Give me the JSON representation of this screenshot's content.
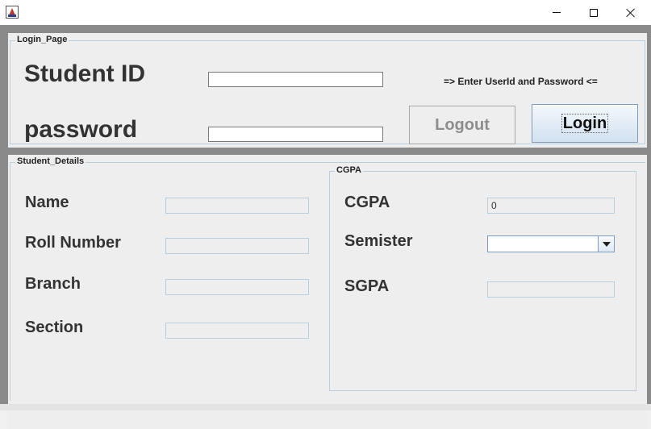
{
  "window": {
    "icons": {
      "app": "java-cup-icon",
      "minimize": "minimize-icon",
      "maximize": "maximize-icon",
      "close": "close-icon"
    }
  },
  "login_panel": {
    "legend": "Login_Page",
    "student_id_label": "Student ID",
    "student_id_value": "",
    "password_label": "password",
    "password_value": "",
    "hint": "=> Enter UserId and Password <=",
    "logout_label": "Logout",
    "login_label": "Login"
  },
  "details_panel": {
    "legend": "Student_Details",
    "name_label": "Name",
    "name_value": "",
    "roll_label": "Roll Number",
    "roll_value": "",
    "branch_label": "Branch",
    "branch_value": "",
    "section_label": "Section",
    "section_value": ""
  },
  "cgpa_panel": {
    "legend": "CGPA",
    "cgpa_label": "CGPA",
    "cgpa_value": "0",
    "semister_label": "Semister",
    "semister_selected": "",
    "sgpa_label": "SGPA",
    "sgpa_value": ""
  },
  "colors": {
    "panel_bg": "#eeeeee",
    "frame_bg": "#8a8a8a",
    "border_blue": "#b8cfe0",
    "label_text": "#333333"
  }
}
